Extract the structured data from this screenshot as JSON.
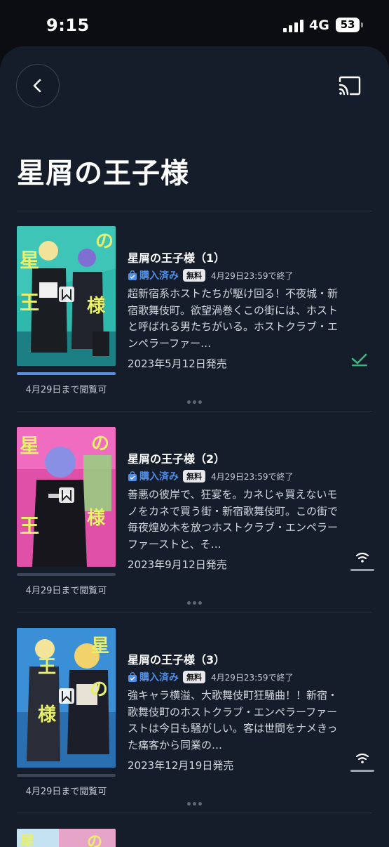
{
  "status_bar": {
    "time": "9:15",
    "network": "4G",
    "battery": "53"
  },
  "header": {
    "title": "星屑の王子様"
  },
  "colors": {
    "accent": "#4f8fe8",
    "check": "#3fb67e",
    "background": "#151c2a"
  },
  "volumes": [
    {
      "title": "星屑の王子様（1）",
      "purchased_label": "購入済み",
      "free_label": "無料",
      "deadline": "4月29日23:59で終了",
      "description": "超新宿系ホストたちが駆け回る！不夜城・新宿歌舞伎町。欲望渦巻くこの街には、ホストと呼ばれる男たちがいる。ホストクラブ・エンペラーファー…",
      "release": "2023年5月12日発売",
      "availability": "4月29日まで閲覧可",
      "read_progress": 1.0,
      "status_icon": "check-icon"
    },
    {
      "title": "星屑の王子様（2）",
      "purchased_label": "購入済み",
      "free_label": "無料",
      "deadline": "4月29日23:59で終了",
      "description": "善悪の彼岸で、狂宴を。カネじゃ買えないモノをカネで買う街・新宿歌舞伎町。この街で毎夜煌め木を放つホストクラブ・エンペラーファーストと、そ…",
      "release": "2023年9月12日発売",
      "availability": "4月29日まで閲覧可",
      "read_progress": 0.0,
      "status_icon": "download-icon"
    },
    {
      "title": "星屑の王子様（3）",
      "purchased_label": "購入済み",
      "free_label": "無料",
      "deadline": "4月29日23:59で終了",
      "description": "強キャラ横溢、大歌舞伎町狂騒曲！！新宿・歌舞伎町のホストクラブ・エンペラーファーストは今日も騒がしい。客は世間をナメきった痛客から同業の…",
      "release": "2023年12月19日発売",
      "availability": "4月29日まで閲覧可",
      "read_progress": 0.0,
      "status_icon": "download-icon"
    }
  ]
}
